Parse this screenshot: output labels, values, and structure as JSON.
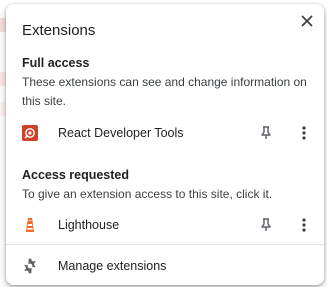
{
  "popup": {
    "title": "Extensions",
    "close_icon": "close-icon"
  },
  "full_access": {
    "heading": "Full access",
    "description": "These extensions can see and change information on this site.",
    "extensions": [
      {
        "name": "React Developer Tools",
        "icon": "react-devtools-icon",
        "icon_color": "#d0412b"
      }
    ]
  },
  "access_requested": {
    "heading": "Access requested",
    "description": "To give an extension access to this site, click it.",
    "extensions": [
      {
        "name": "Lighthouse",
        "icon": "lighthouse-icon",
        "icon_color": "#f26b2a"
      }
    ]
  },
  "footer": {
    "manage_label": "Manage extensions",
    "manage_icon": "gear-icon"
  },
  "colors": {
    "text": "#202124",
    "icon_gray": "#5f6368",
    "divider": "#e3e3e3"
  }
}
